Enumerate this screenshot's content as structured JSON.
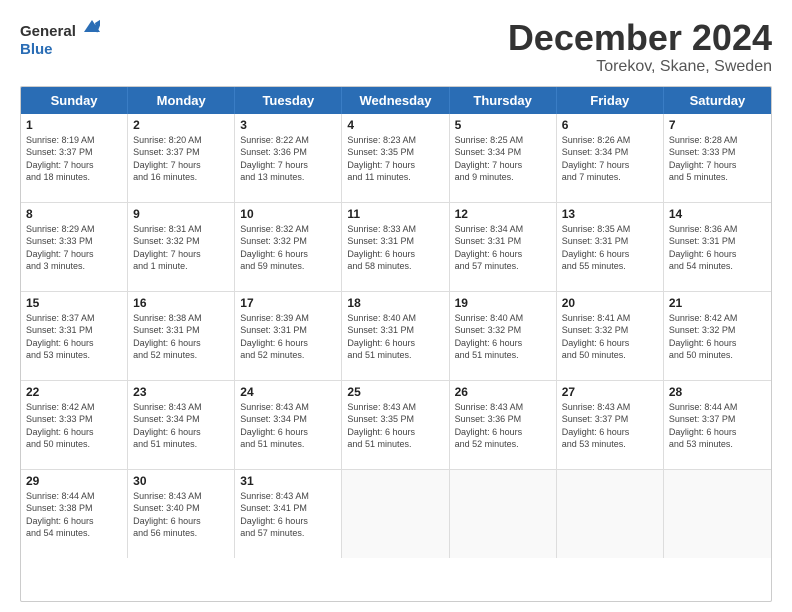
{
  "header": {
    "logo_line1": "General",
    "logo_line2": "Blue",
    "title": "December 2024",
    "subtitle": "Torekov, Skane, Sweden"
  },
  "days_of_week": [
    "Sunday",
    "Monday",
    "Tuesday",
    "Wednesday",
    "Thursday",
    "Friday",
    "Saturday"
  ],
  "weeks": [
    [
      {
        "day": "1",
        "info": "Sunrise: 8:19 AM\nSunset: 3:37 PM\nDaylight: 7 hours\nand 18 minutes."
      },
      {
        "day": "2",
        "info": "Sunrise: 8:20 AM\nSunset: 3:37 PM\nDaylight: 7 hours\nand 16 minutes."
      },
      {
        "day": "3",
        "info": "Sunrise: 8:22 AM\nSunset: 3:36 PM\nDaylight: 7 hours\nand 13 minutes."
      },
      {
        "day": "4",
        "info": "Sunrise: 8:23 AM\nSunset: 3:35 PM\nDaylight: 7 hours\nand 11 minutes."
      },
      {
        "day": "5",
        "info": "Sunrise: 8:25 AM\nSunset: 3:34 PM\nDaylight: 7 hours\nand 9 minutes."
      },
      {
        "day": "6",
        "info": "Sunrise: 8:26 AM\nSunset: 3:34 PM\nDaylight: 7 hours\nand 7 minutes."
      },
      {
        "day": "7",
        "info": "Sunrise: 8:28 AM\nSunset: 3:33 PM\nDaylight: 7 hours\nand 5 minutes."
      }
    ],
    [
      {
        "day": "8",
        "info": "Sunrise: 8:29 AM\nSunset: 3:33 PM\nDaylight: 7 hours\nand 3 minutes."
      },
      {
        "day": "9",
        "info": "Sunrise: 8:31 AM\nSunset: 3:32 PM\nDaylight: 7 hours\nand 1 minute."
      },
      {
        "day": "10",
        "info": "Sunrise: 8:32 AM\nSunset: 3:32 PM\nDaylight: 6 hours\nand 59 minutes."
      },
      {
        "day": "11",
        "info": "Sunrise: 8:33 AM\nSunset: 3:31 PM\nDaylight: 6 hours\nand 58 minutes."
      },
      {
        "day": "12",
        "info": "Sunrise: 8:34 AM\nSunset: 3:31 PM\nDaylight: 6 hours\nand 57 minutes."
      },
      {
        "day": "13",
        "info": "Sunrise: 8:35 AM\nSunset: 3:31 PM\nDaylight: 6 hours\nand 55 minutes."
      },
      {
        "day": "14",
        "info": "Sunrise: 8:36 AM\nSunset: 3:31 PM\nDaylight: 6 hours\nand 54 minutes."
      }
    ],
    [
      {
        "day": "15",
        "info": "Sunrise: 8:37 AM\nSunset: 3:31 PM\nDaylight: 6 hours\nand 53 minutes."
      },
      {
        "day": "16",
        "info": "Sunrise: 8:38 AM\nSunset: 3:31 PM\nDaylight: 6 hours\nand 52 minutes."
      },
      {
        "day": "17",
        "info": "Sunrise: 8:39 AM\nSunset: 3:31 PM\nDaylight: 6 hours\nand 52 minutes."
      },
      {
        "day": "18",
        "info": "Sunrise: 8:40 AM\nSunset: 3:31 PM\nDaylight: 6 hours\nand 51 minutes."
      },
      {
        "day": "19",
        "info": "Sunrise: 8:40 AM\nSunset: 3:32 PM\nDaylight: 6 hours\nand 51 minutes."
      },
      {
        "day": "20",
        "info": "Sunrise: 8:41 AM\nSunset: 3:32 PM\nDaylight: 6 hours\nand 50 minutes."
      },
      {
        "day": "21",
        "info": "Sunrise: 8:42 AM\nSunset: 3:32 PM\nDaylight: 6 hours\nand 50 minutes."
      }
    ],
    [
      {
        "day": "22",
        "info": "Sunrise: 8:42 AM\nSunset: 3:33 PM\nDaylight: 6 hours\nand 50 minutes."
      },
      {
        "day": "23",
        "info": "Sunrise: 8:43 AM\nSunset: 3:34 PM\nDaylight: 6 hours\nand 51 minutes."
      },
      {
        "day": "24",
        "info": "Sunrise: 8:43 AM\nSunset: 3:34 PM\nDaylight: 6 hours\nand 51 minutes."
      },
      {
        "day": "25",
        "info": "Sunrise: 8:43 AM\nSunset: 3:35 PM\nDaylight: 6 hours\nand 51 minutes."
      },
      {
        "day": "26",
        "info": "Sunrise: 8:43 AM\nSunset: 3:36 PM\nDaylight: 6 hours\nand 52 minutes."
      },
      {
        "day": "27",
        "info": "Sunrise: 8:43 AM\nSunset: 3:37 PM\nDaylight: 6 hours\nand 53 minutes."
      },
      {
        "day": "28",
        "info": "Sunrise: 8:44 AM\nSunset: 3:37 PM\nDaylight: 6 hours\nand 53 minutes."
      }
    ],
    [
      {
        "day": "29",
        "info": "Sunrise: 8:44 AM\nSunset: 3:38 PM\nDaylight: 6 hours\nand 54 minutes."
      },
      {
        "day": "30",
        "info": "Sunrise: 8:43 AM\nSunset: 3:40 PM\nDaylight: 6 hours\nand 56 minutes."
      },
      {
        "day": "31",
        "info": "Sunrise: 8:43 AM\nSunset: 3:41 PM\nDaylight: 6 hours\nand 57 minutes."
      },
      {
        "day": "",
        "info": ""
      },
      {
        "day": "",
        "info": ""
      },
      {
        "day": "",
        "info": ""
      },
      {
        "day": "",
        "info": ""
      }
    ]
  ]
}
